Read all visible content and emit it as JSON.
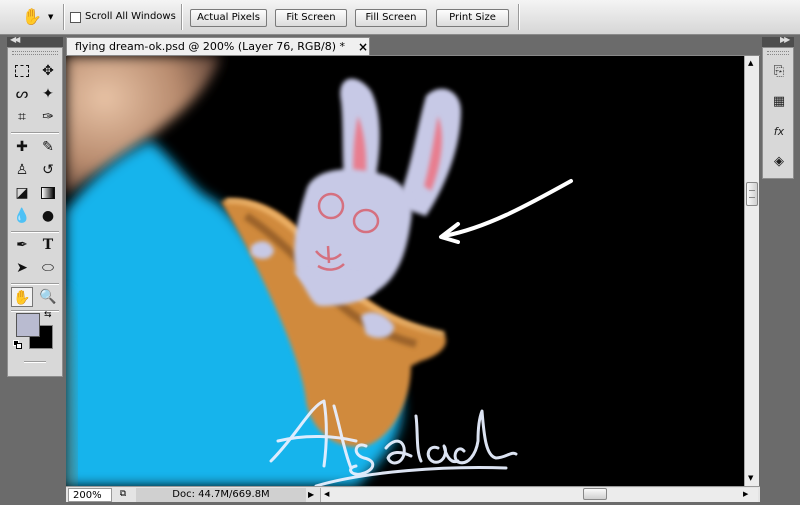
{
  "options_bar": {
    "hand_tool_icon": "hand-icon",
    "scroll_all_windows_label": "Scroll All Windows",
    "scroll_all_windows_checked": false,
    "buttons": [
      "Actual Pixels",
      "Fit Screen",
      "Fill Screen",
      "Print Size"
    ]
  },
  "document": {
    "tab_title": "flying dream-ok.psd @ 200% (Layer 76, RGB/8) *",
    "close_glyph": "×",
    "artwork_signature": "Alsalad"
  },
  "status_bar": {
    "zoom": "200%",
    "doc_info": "Doc: 44.7M/669.8M"
  },
  "colors": {
    "foreground": "#b9bbd0",
    "background": "#000000",
    "sky_blue": "#1ab3ea",
    "pouch": "#d9923f",
    "bunny": "#c7c9e6"
  }
}
